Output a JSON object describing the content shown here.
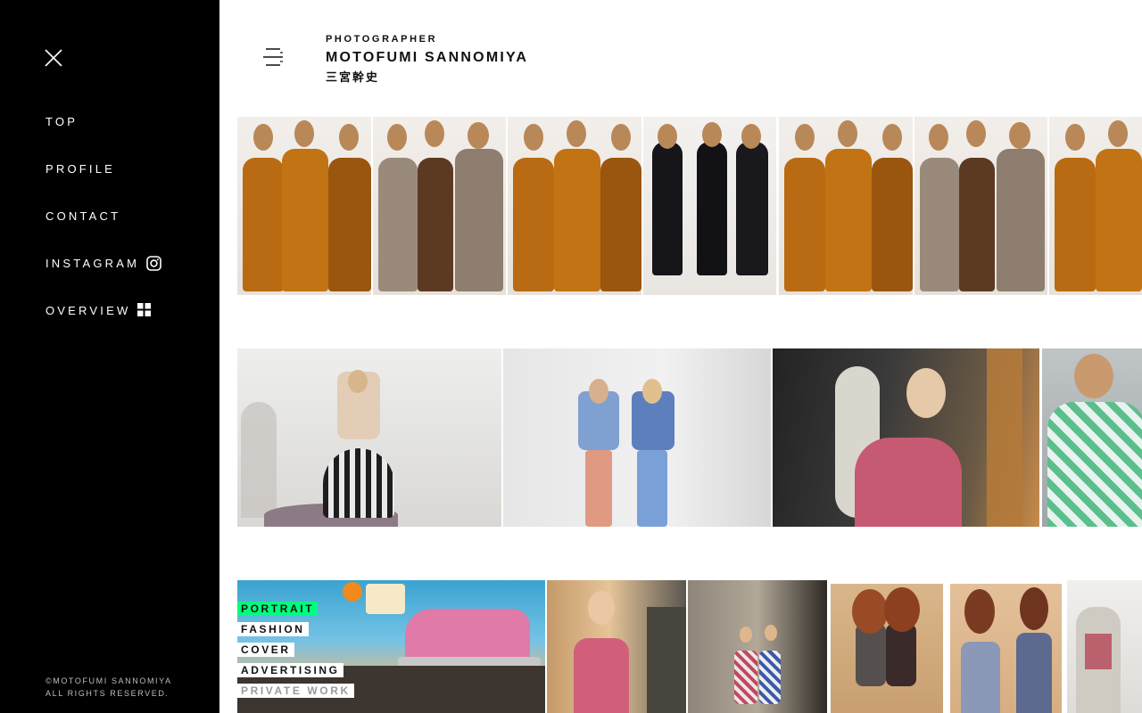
{
  "sidebar": {
    "nav": [
      {
        "label": "TOP"
      },
      {
        "label": "PROFILE"
      },
      {
        "label": "CONTACT"
      },
      {
        "label": "INSTAGRAM",
        "icon": "instagram-icon"
      },
      {
        "label": "OVERVIEW",
        "icon": "grid-icon"
      }
    ],
    "copyright_line1": "©MOTOFUMI SANNOMIYA",
    "copyright_line2": "ALL RIGHTS RESERVED."
  },
  "header": {
    "role": "PHOTOGRAPHER",
    "name": "MOTOFUMI SANNOMIYA",
    "name_jp": "三宮幹史"
  },
  "categories": [
    {
      "label": "PORTRAIT",
      "active": true
    },
    {
      "label": "FASHION"
    },
    {
      "label": "COVER"
    },
    {
      "label": "ADVERTISING"
    },
    {
      "label": "PRIVATE WORK",
      "muted": true
    }
  ],
  "colors": {
    "sidebar_bg": "#000000",
    "accent_green": "#00ff7f",
    "text_dark": "#111111"
  }
}
